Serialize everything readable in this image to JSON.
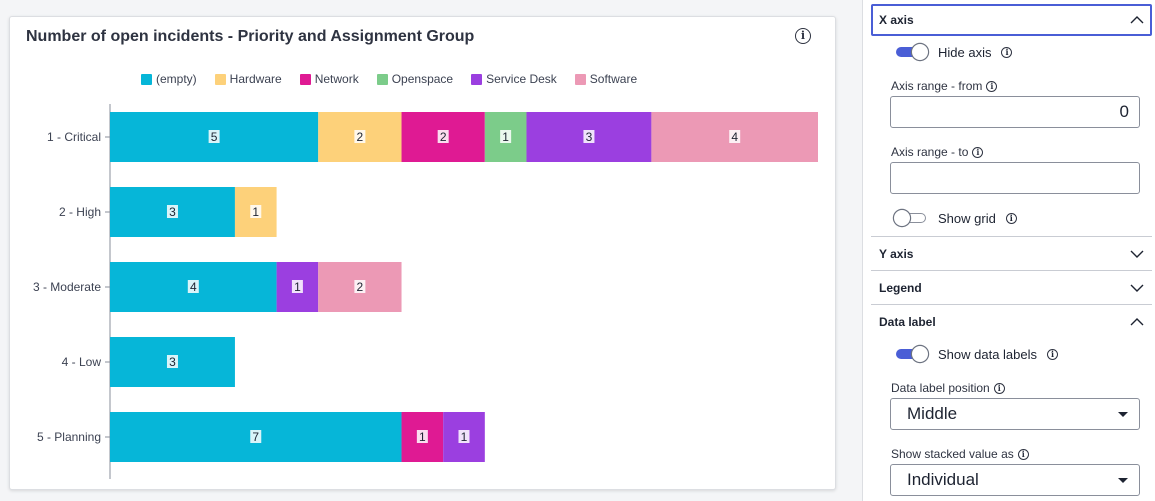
{
  "chart_card": {
    "title": "Number of open incidents - Priority and Assignment Group",
    "info_icon": "info-icon"
  },
  "chart_data": {
    "type": "bar",
    "orientation": "horizontal",
    "stacked": true,
    "title": "Number of open incidents - Priority and Assignment Group",
    "categories": [
      "1 - Critical",
      "2 - High",
      "3 - Moderate",
      "4 - Low",
      "5 - Planning"
    ],
    "series": [
      {
        "name": "(empty)",
        "color": "#06b6d8",
        "values": [
          5,
          3,
          4,
          3,
          7
        ]
      },
      {
        "name": "Hardware",
        "color": "#fdd17a",
        "values": [
          2,
          1,
          0,
          0,
          0
        ]
      },
      {
        "name": "Network",
        "color": "#df1a93",
        "values": [
          2,
          0,
          0,
          0,
          1
        ]
      },
      {
        "name": "Openspace",
        "color": "#7ccc8a",
        "values": [
          1,
          0,
          0,
          0,
          0
        ]
      },
      {
        "name": "Service Desk",
        "color": "#9b3fe0",
        "values": [
          3,
          0,
          1,
          0,
          1
        ]
      },
      {
        "name": "Software",
        "color": "#ec99b5",
        "values": [
          4,
          0,
          2,
          0,
          0
        ]
      }
    ],
    "xlim": [
      0,
      17
    ],
    "x_axis_hidden": true,
    "grid": false,
    "legend_position": "top",
    "data_labels": true,
    "data_label_position": "middle"
  },
  "panel": {
    "x_axis": {
      "header": "X axis",
      "hide_axis_label": "Hide axis",
      "hide_axis_on": true,
      "range_from_label": "Axis range - from",
      "range_from_value": "0",
      "range_to_label": "Axis range - to",
      "range_to_value": "",
      "show_grid_label": "Show grid",
      "show_grid_on": false
    },
    "y_axis": {
      "header": "Y axis"
    },
    "legend": {
      "header": "Legend"
    },
    "data_label": {
      "header": "Data label",
      "show_labels_label": "Show data labels",
      "show_labels_on": true,
      "position_label": "Data label position",
      "position_value": "Middle",
      "stacked_label": "Show stacked value as",
      "stacked_value": "Individual"
    }
  },
  "colors": {
    "accent": "#4a5ed6"
  }
}
